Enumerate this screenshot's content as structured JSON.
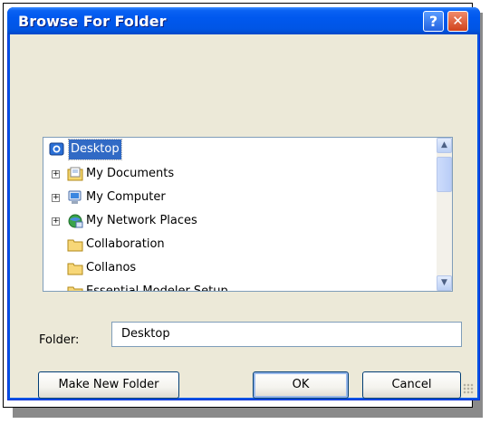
{
  "dialog": {
    "title": "Browse For Folder",
    "help_glyph": "?",
    "close_glyph": "✕"
  },
  "tree": {
    "items": [
      {
        "label": "Desktop",
        "icon": "desktop-icon",
        "expander": "",
        "selected": true
      },
      {
        "label": "My Documents",
        "icon": "my-documents-icon",
        "expander": "+"
      },
      {
        "label": "My Computer",
        "icon": "computer-icon",
        "expander": "+"
      },
      {
        "label": "My Network Places",
        "icon": "network-places-icon",
        "expander": "+"
      },
      {
        "label": "Collaboration",
        "icon": "folder-icon",
        "expander": ""
      },
      {
        "label": "Collanos",
        "icon": "folder-icon",
        "expander": ""
      },
      {
        "label": "Essential Modeler Setup",
        "icon": "folder-icon",
        "expander": ""
      }
    ]
  },
  "folder": {
    "label": "Folder:",
    "value": "Desktop"
  },
  "buttons": {
    "make_new_folder": "Make New Folder",
    "ok": "OK",
    "cancel": "Cancel"
  },
  "colors": {
    "title_bar": "#0054e3",
    "selection": "#316ac5",
    "dialog_face": "#ece9d8"
  }
}
